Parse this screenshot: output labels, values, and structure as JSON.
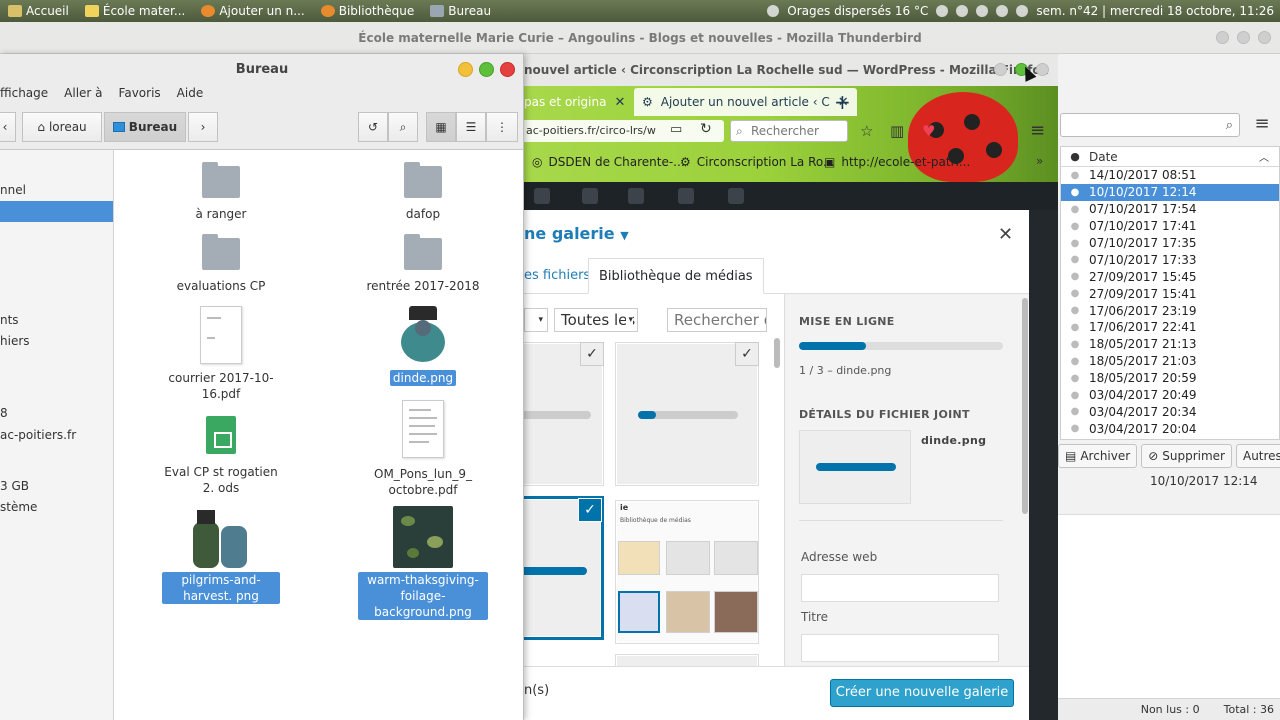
{
  "system_panel": {
    "tasks": [
      "Accueil",
      "École mater...",
      "Ajouter un n...",
      "Bibliothèque",
      "Bureau"
    ],
    "weather": "Orages dispersés 16 °C",
    "clock": "sem. n°42 | mercredi 18 octobre, 11:26"
  },
  "thunderbird": {
    "title": "École maternelle Marie Curie – Angoulins - Blogs et nouvelles - Mozilla Thunderbird",
    "column_date": "Date",
    "dates": [
      "14/10/2017 08:51",
      "10/10/2017 12:14",
      "07/10/2017 17:54",
      "07/10/2017 17:41",
      "07/10/2017 17:35",
      "07/10/2017 17:33",
      "27/09/2017 15:45",
      "27/09/2017 15:41",
      "17/06/2017 23:19",
      "17/06/2017 22:41",
      "18/05/2017 21:13",
      "18/05/2017 21:03",
      "18/05/2017 20:59",
      "03/04/2017 20:49",
      "03/04/2017 20:34",
      "03/04/2017 20:04"
    ],
    "selected_index": 1,
    "actions": {
      "archive": "Archiver",
      "delete": "Supprimer",
      "others": "Autres"
    },
    "message_date": "10/10/2017 12:14",
    "status": {
      "unread": "Non lus : 0",
      "total": "Total : 36"
    }
  },
  "firefox": {
    "title": "nouvel article ‹ Circonscription La Rochelle sud — WordPress - Mozilla Firefox",
    "tab1": "pas et origina",
    "tab2": "Ajouter un nouvel article ‹ C",
    "url": "ac-poitiers.fr/circo-lrs/w",
    "search_placeholder": "Rechercher",
    "bookmarks": [
      "DSDEN de Charente-...",
      "Circonscription La Ro...",
      "http://ecole-et-patri..."
    ]
  },
  "media_modal": {
    "title": "ne galerie",
    "tab_upload": "es fichiers",
    "tab_library": "Bibliothèque de médias",
    "filter_value": "Toutes les",
    "search_placeholder": "Rechercher d",
    "sidebar": {
      "upload_heading": "MISE EN LIGNE",
      "upload_progress": 0.33,
      "upload_status": "1 / 3 – dinde.png",
      "details_heading": "DÉTAILS DU FICHIER JOINT",
      "filename": "dinde.png",
      "url_label": "Adresse web",
      "title_label": "Titre"
    },
    "footer_left": "n(s)",
    "create_button": "Créer une nouvelle galerie",
    "shot_label": "ie",
    "shot_sublabel": "Bibliothèque de médias"
  },
  "nautilus": {
    "title": "Bureau",
    "menu": [
      "ffichage",
      "Aller à",
      "Favoris",
      "Aide"
    ],
    "path": [
      "loreau",
      "Bureau"
    ],
    "sidebar": [
      "nnel",
      "",
      "nts",
      "hiers",
      "8",
      "ac-poitiers.fr",
      "3 GB",
      "stème"
    ],
    "files": [
      {
        "name": "à ranger",
        "kind": "folder"
      },
      {
        "name": "dafop",
        "kind": "folder"
      },
      {
        "name": "evaluations CP",
        "kind": "folder"
      },
      {
        "name": "rentrée 2017-2018",
        "kind": "folder"
      },
      {
        "name": "courrier 2017-10-16.pdf",
        "kind": "pdf"
      },
      {
        "name": "dinde.png",
        "kind": "image"
      },
      {
        "name": "Eval CP st rogatien 2. ods",
        "kind": "sheet"
      },
      {
        "name": "OM_Pons_lun_9_ octobre.pdf",
        "kind": "pdf"
      },
      {
        "name": "pilgrims-and-harvest. png",
        "kind": "image"
      },
      {
        "name": "warm-thaksgiving- foilage-background.png",
        "kind": "image"
      }
    ]
  },
  "colors": {
    "wp_blue": "#0073aa",
    "select_blue": "#4a90d9",
    "firefox_green": "#9bd13b"
  }
}
